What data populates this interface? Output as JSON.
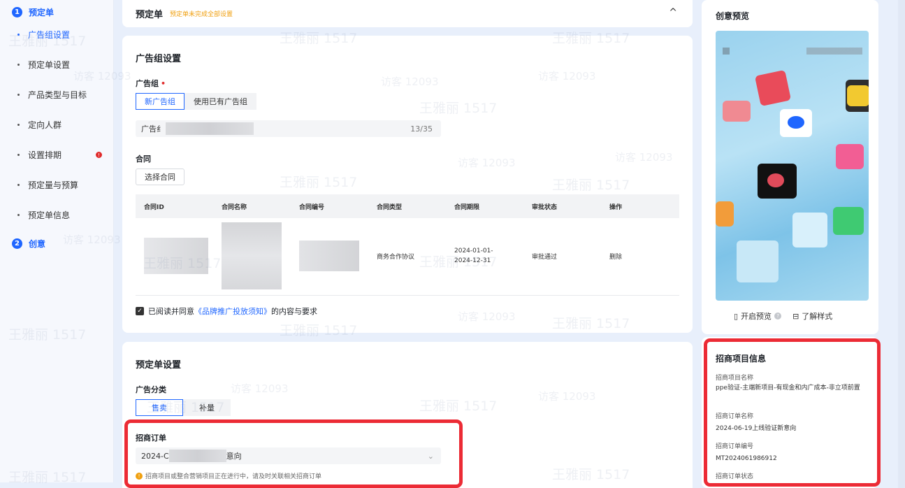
{
  "sidebar": {
    "steps": [
      {
        "num": "1",
        "label": "预定单"
      },
      {
        "num": "2",
        "label": "创意"
      }
    ],
    "items": [
      {
        "label": "广告组设置"
      },
      {
        "label": "预定单设置"
      },
      {
        "label": "产品类型与目标"
      },
      {
        "label": "定向人群"
      },
      {
        "label": "设置排期"
      },
      {
        "label": "预定量与预算"
      },
      {
        "label": "预定单信息"
      }
    ],
    "warn_icon": "!"
  },
  "header": {
    "title": "预定单",
    "tag": "预定单未完成全部设置",
    "chevron": "^"
  },
  "ad_group": {
    "section_title": "广告组设置",
    "field_label": "广告组",
    "required_mark": "•",
    "options": [
      "新广告组",
      "使用已有广告组"
    ],
    "name_prefix": "广告纟",
    "counter": "13/35"
  },
  "contract": {
    "label": "合同",
    "select_button": "选择合同",
    "columns": [
      "合同ID",
      "合同名称",
      "合同编号",
      "合同类型",
      "合同期限",
      "审批状态",
      "操作"
    ],
    "row": {
      "type": "商务合作协议",
      "period_start": "2024-01-01-",
      "period_end": "2024-12-31",
      "status": "审批通过",
      "action": "删除"
    }
  },
  "agreement": {
    "check": "✓",
    "prefix": "已阅读并同意",
    "link": "《品牌推广投放须知》",
    "suffix": "的内容与要求"
  },
  "order_settings": {
    "section_title": "预定单设置",
    "category_label": "广告分类",
    "category_options": [
      "售卖",
      "补量"
    ],
    "merchant_order_label": "招商订单",
    "merchant_order_value_prefix": "2024-C",
    "merchant_order_value_suffix": "意向",
    "chevron": "⌄",
    "hint_icon": "!",
    "hint": "招商项目或整合营销项目正在进行中，请及时关联相关招商订单"
  },
  "preview": {
    "title": "创意预览",
    "open_preview": "开启预览",
    "help_icon": "?",
    "learn_style": "了解样式",
    "phone_icon": "▯",
    "style_icon": "⊟"
  },
  "merchant_info": {
    "title": "招商项目信息",
    "fields": [
      {
        "label": "招商项目名称",
        "value": "ppe验证-主端新项目-有现金和内广成本-非立项前置"
      },
      {
        "label": "招商订单名称",
        "value": "2024-06-19上线验证新意向"
      },
      {
        "label": "招商订单编号",
        "value": "MT2024061986912"
      },
      {
        "label": "招商订单状态",
        "value": ""
      }
    ]
  },
  "watermarks": {
    "name": "王雅丽 1517",
    "visitor": "访客 12093"
  },
  "colors": {
    "primary": "#1f66ff",
    "warning": "#f0a010",
    "danger": "#e02b2b",
    "highlight": "#ec2b35"
  }
}
